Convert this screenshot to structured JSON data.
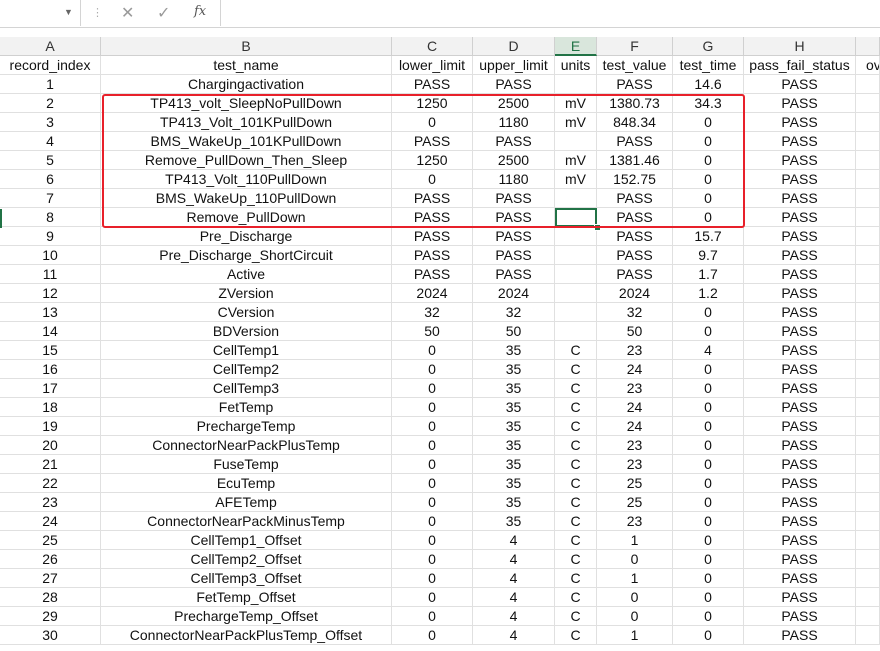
{
  "formula_bar": {
    "name_box": "",
    "cancel_icon": "✕",
    "enter_icon": "✓",
    "fx_label": "fx",
    "formula": ""
  },
  "columns": [
    "A",
    "B",
    "C",
    "D",
    "E",
    "F",
    "G",
    "H"
  ],
  "selected_column": "E",
  "headers": [
    "record_index",
    "test_name",
    "lower_limit",
    "upper_limit",
    "units",
    "test_value",
    "test_time",
    "pass_fail_status",
    "ov"
  ],
  "rows": [
    [
      "1",
      "Chargingactivation",
      "PASS",
      "PASS",
      "",
      "PASS",
      "14.6",
      "PASS"
    ],
    [
      "2",
      "TP413_volt_SleepNoPullDown",
      "1250",
      "2500",
      "mV",
      "1380.73",
      "34.3",
      "PASS"
    ],
    [
      "3",
      "TP413_Volt_101KPullDown",
      "0",
      "1180",
      "mV",
      "848.34",
      "0",
      "PASS"
    ],
    [
      "4",
      "BMS_WakeUp_101KPullDown",
      "PASS",
      "PASS",
      "",
      "PASS",
      "0",
      "PASS"
    ],
    [
      "5",
      "Remove_PullDown_Then_Sleep",
      "1250",
      "2500",
      "mV",
      "1381.46",
      "0",
      "PASS"
    ],
    [
      "6",
      "TP413_Volt_110PullDown",
      "0",
      "1180",
      "mV",
      "152.75",
      "0",
      "PASS"
    ],
    [
      "7",
      "BMS_WakeUp_110PullDown",
      "PASS",
      "PASS",
      "",
      "PASS",
      "0",
      "PASS"
    ],
    [
      "8",
      "Remove_PullDown",
      "PASS",
      "PASS",
      "",
      "PASS",
      "0",
      "PASS"
    ],
    [
      "9",
      "Pre_Discharge",
      "PASS",
      "PASS",
      "",
      "PASS",
      "15.7",
      "PASS"
    ],
    [
      "10",
      "Pre_Discharge_ShortCircuit",
      "PASS",
      "PASS",
      "",
      "PASS",
      "9.7",
      "PASS"
    ],
    [
      "11",
      "Active",
      "PASS",
      "PASS",
      "",
      "PASS",
      "1.7",
      "PASS"
    ],
    [
      "12",
      "ZVersion",
      "2024",
      "2024",
      "",
      "2024",
      "1.2",
      "PASS"
    ],
    [
      "13",
      "CVersion",
      "32",
      "32",
      "",
      "32",
      "0",
      "PASS"
    ],
    [
      "14",
      "BDVersion",
      "50",
      "50",
      "",
      "50",
      "0",
      "PASS"
    ],
    [
      "15",
      "CellTemp1",
      "0",
      "35",
      "C",
      "23",
      "4",
      "PASS"
    ],
    [
      "16",
      "CellTemp2",
      "0",
      "35",
      "C",
      "24",
      "0",
      "PASS"
    ],
    [
      "17",
      "CellTemp3",
      "0",
      "35",
      "C",
      "23",
      "0",
      "PASS"
    ],
    [
      "18",
      "FetTemp",
      "0",
      "35",
      "C",
      "24",
      "0",
      "PASS"
    ],
    [
      "19",
      "PrechargeTemp",
      "0",
      "35",
      "C",
      "24",
      "0",
      "PASS"
    ],
    [
      "20",
      "ConnectorNearPackPlusTemp",
      "0",
      "35",
      "C",
      "23",
      "0",
      "PASS"
    ],
    [
      "21",
      "FuseTemp",
      "0",
      "35",
      "C",
      "23",
      "0",
      "PASS"
    ],
    [
      "22",
      "EcuTemp",
      "0",
      "35",
      "C",
      "25",
      "0",
      "PASS"
    ],
    [
      "23",
      "AFETemp",
      "0",
      "35",
      "C",
      "25",
      "0",
      "PASS"
    ],
    [
      "24",
      "ConnectorNearPackMinusTemp",
      "0",
      "35",
      "C",
      "23",
      "0",
      "PASS"
    ],
    [
      "25",
      "CellTemp1_Offset",
      "0",
      "4",
      "C",
      "1",
      "0",
      "PASS"
    ],
    [
      "26",
      "CellTemp2_Offset",
      "0",
      "4",
      "C",
      "0",
      "0",
      "PASS"
    ],
    [
      "27",
      "CellTemp3_Offset",
      "0",
      "4",
      "C",
      "1",
      "0",
      "PASS"
    ],
    [
      "28",
      "FetTemp_Offset",
      "0",
      "4",
      "C",
      "0",
      "0",
      "PASS"
    ],
    [
      "29",
      "PrechargeTemp_Offset",
      "0",
      "4",
      "C",
      "0",
      "0",
      "PASS"
    ],
    [
      "30",
      "ConnectorNearPackPlusTemp_Offset",
      "0",
      "4",
      "C",
      "1",
      "0",
      "PASS"
    ]
  ],
  "colors": {
    "accent": "#217346",
    "highlight_box": "#e8202a"
  }
}
